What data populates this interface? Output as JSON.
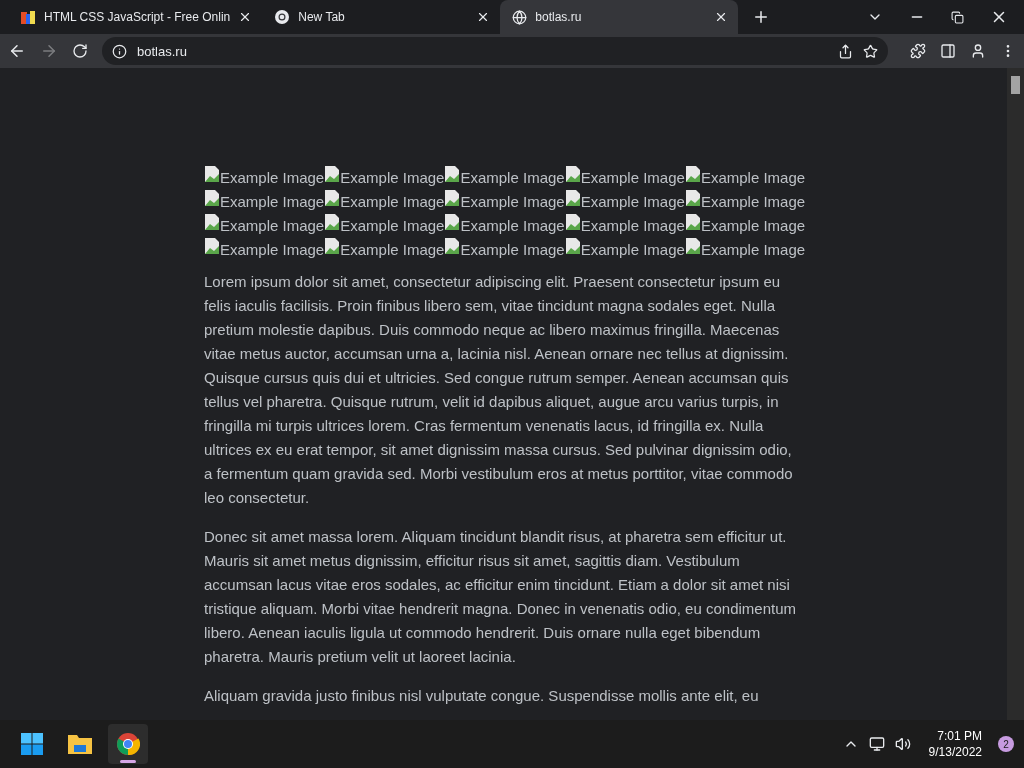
{
  "tabs": [
    {
      "title": "HTML CSS JavaScript - Free Onlin",
      "selected": false
    },
    {
      "title": "New Tab",
      "selected": false
    },
    {
      "title": "botlas.ru",
      "selected": true
    }
  ],
  "address_bar": {
    "url": "botlas.ru"
  },
  "images": [
    {
      "alt": "Example Image"
    },
    {
      "alt": "Example Image"
    },
    {
      "alt": "Example Image"
    },
    {
      "alt": "Example Image"
    },
    {
      "alt": "Example Image"
    },
    {
      "alt": "Example Image"
    },
    {
      "alt": "Example Image"
    },
    {
      "alt": "Example Image"
    },
    {
      "alt": "Example Image"
    },
    {
      "alt": "Example Image"
    },
    {
      "alt": "Example Image"
    },
    {
      "alt": "Example Image"
    },
    {
      "alt": "Example Image"
    },
    {
      "alt": "Example Image"
    },
    {
      "alt": "Example Image"
    },
    {
      "alt": "Example Image"
    },
    {
      "alt": "Example Image"
    },
    {
      "alt": "Example Image"
    },
    {
      "alt": "Example Image"
    },
    {
      "alt": "Example Image"
    }
  ],
  "paragraphs": [
    "Lorem ipsum dolor sit amet, consectetur adipiscing elit. Praesent consectetur ipsum eu felis iaculis facilisis. Proin finibus libero sem, vitae tincidunt magna sodales eget. Nulla pretium molestie dapibus. Duis commodo neque ac libero maximus fringilla. Maecenas vitae metus auctor, accumsan urna a, lacinia nisl. Aenean ornare nec tellus at dignissim. Quisque cursus quis dui et ultricies. Sed congue rutrum semper. Aenean accumsan quis tellus vel pharetra. Quisque rutrum, velit id dapibus aliquet, augue arcu varius turpis, in fringilla mi turpis ultrices lorem. Cras fermentum venenatis lacus, id fringilla ex. Nulla ultrices ex eu erat tempor, sit amet dignissim massa cursus. Sed pulvinar dignissim odio, a fermentum quam gravida sed. Morbi vestibulum eros at metus porttitor, vitae commodo leo consectetur.",
    "Donec sit amet massa lorem. Aliquam tincidunt blandit risus, at pharetra sem efficitur ut. Mauris sit amet metus dignissim, efficitur risus sit amet, sagittis diam. Vestibulum accumsan lacus vitae eros sodales, ac efficitur enim tincidunt. Etiam a dolor sit amet nisi tristique aliquam. Morbi vitae hendrerit magna. Donec in venenatis odio, eu condimentum libero. Aenean iaculis ligula ut commodo hendrerit. Duis ornare nulla eget bibendum pharetra. Mauris pretium velit ut laoreet lacinia.",
    "Aliquam gravida justo finibus nisl vulputate congue. Suspendisse mollis ante elit, eu"
  ],
  "taskbar": {
    "apps": [
      {
        "selected": false
      },
      {
        "selected": false
      },
      {
        "selected": true
      }
    ],
    "time": "7:01 PM",
    "date": "9/13/2022",
    "notifications": "2"
  }
}
